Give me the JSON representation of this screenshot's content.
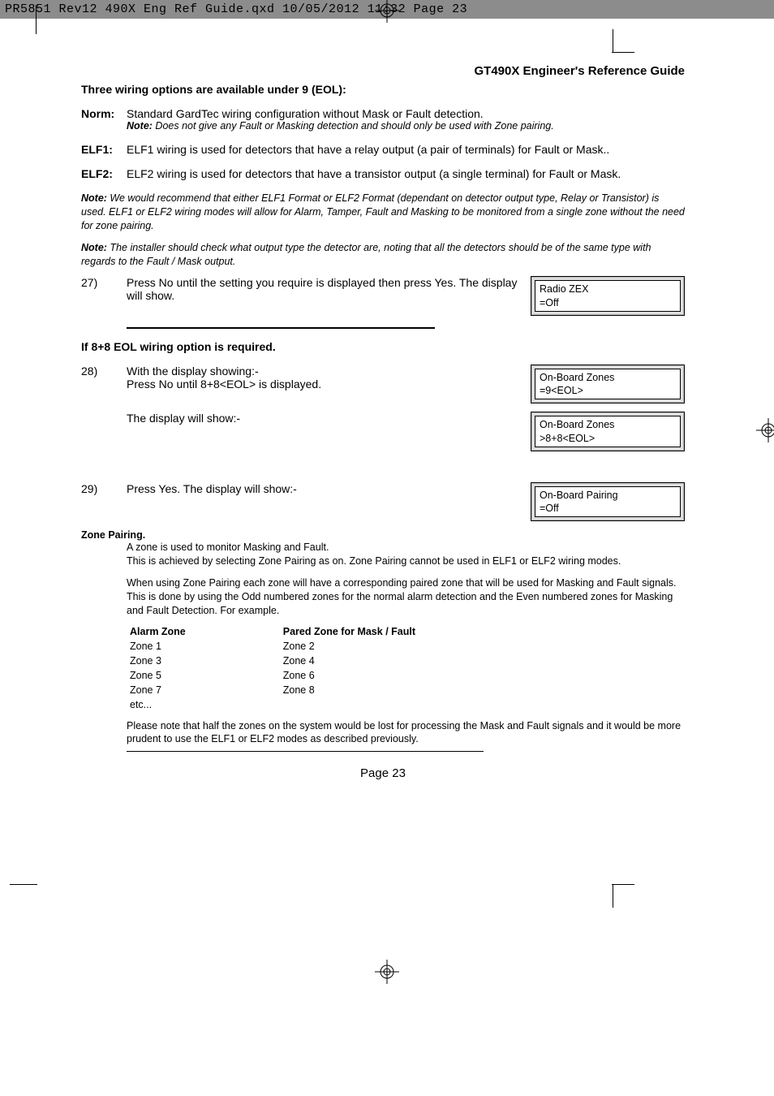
{
  "header": "PR5851 Rev12 490X Eng Ref Guide.qxd  10/05/2012  11:32  Page 23",
  "doc_title": "GT490X Engineer's Reference Guide",
  "section_heading": "Three wiring options are available under 9 (EOL):",
  "options": {
    "norm": {
      "label": "Norm:",
      "text": "Standard GardTec wiring configuration without Mask or Fault detection.",
      "note_prefix": "Note:",
      "note": " Does not give any Fault or Masking detection and should only be used with Zone pairing."
    },
    "elf1": {
      "label": "ELF1:",
      "text": "ELF1 wiring is used for detectors that have a relay output (a pair of terminals) for Fault or Mask.."
    },
    "elf2": {
      "label": "ELF2:",
      "text": "ELF2 wiring is used for detectors that have a transistor output (a single terminal) for Fault or Mask."
    }
  },
  "note1_prefix": "Note:",
  "note1": " We would recommend that either ELF1 Format or ELF2 Format (dependant on detector output type, Relay or Transistor) is used. ELF1 or ELF2 wiring modes will allow for Alarm, Tamper, Fault and Masking to be monitored from a single zone without the need for zone pairing.",
  "note2_prefix": "Note:",
  "note2": " The installer should check what output type the detector are, noting that all the detectors should be of the same type with regards to the Fault / Mask output.",
  "step27": {
    "num": "27)",
    "text": "Press No until the setting you require is displayed then press Yes. The display will show.",
    "lcd": "Radio ZEX\n=Off"
  },
  "section2": "If  8+8 EOL wiring option is required.",
  "step28": {
    "num": "28)",
    "text1": "With the display showing:-",
    "text2": "Press No until 8+8<EOL> is displayed.",
    "lcd1": "On-Board Zones\n=9<EOL>",
    "text3": "The display will show:-",
    "lcd2": "On-Board Zones\n>8+8<EOL>"
  },
  "step29": {
    "num": "29)",
    "text": "Press Yes. The display will show:-",
    "lcd": "On-Board Pairing\n=Off"
  },
  "zone_pairing": {
    "title": "Zone Pairing.",
    "p1": "A zone is used to monitor Masking and Fault.",
    "p2": "This is achieved by selecting Zone Pairing as on. Zone Pairing cannot be used in ELF1 or ELF2 wiring modes.",
    "p3": "When using Zone Pairing each zone will have a corresponding paired zone that will be used for Masking and Fault signals. This is done by using the Odd numbered zones for the normal alarm detection and the Even numbered zones for Masking and Fault Detection. For example.",
    "col1_h": "Alarm Zone",
    "col1": [
      "Zone 1",
      "Zone 3",
      "Zone 5",
      "Zone 7",
      "etc..."
    ],
    "col2_h": "Pared Zone for Mask / Fault",
    "col2": [
      "Zone 2",
      "Zone 4",
      "Zone 6",
      "Zone 8"
    ],
    "p4": "Please note that half the zones on the system would be lost for processing the Mask and Fault signals and it would be more prudent to use the ELF1 or ELF2 modes as described previously."
  },
  "page": "Page  23"
}
